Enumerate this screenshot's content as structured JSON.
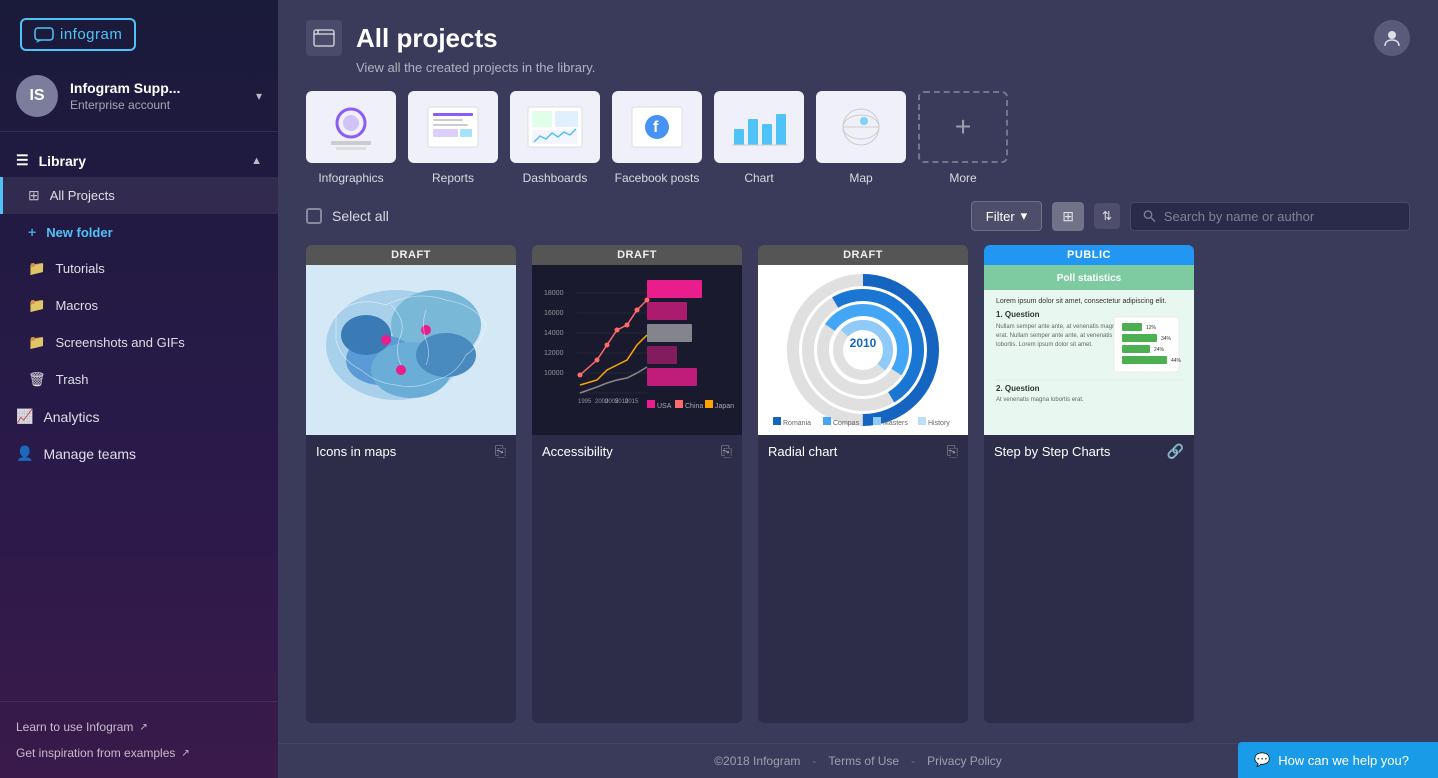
{
  "sidebar": {
    "logo": "infogram",
    "user": {
      "initials": "IS",
      "name": "Infogram Supp...",
      "role": "Enterprise account"
    },
    "library": {
      "label": "Library",
      "items": [
        {
          "id": "all-projects",
          "label": "All Projects",
          "active": true,
          "icon": "⊞"
        },
        {
          "id": "new-folder",
          "label": "New folder",
          "icon": "+"
        },
        {
          "id": "tutorials",
          "label": "Tutorials",
          "icon": "📁"
        },
        {
          "id": "macros",
          "label": "Macros",
          "icon": "📁"
        },
        {
          "id": "screenshots",
          "label": "Screenshots and GIFs",
          "icon": "📁"
        },
        {
          "id": "trash",
          "label": "Trash",
          "icon": "🗑"
        }
      ]
    },
    "analytics": {
      "label": "Analytics",
      "icon": "📈"
    },
    "manage_teams": {
      "label": "Manage teams",
      "icon": "👤"
    },
    "footer": {
      "learn": "Learn to use Infogram",
      "inspiration": "Get inspiration from examples"
    }
  },
  "header": {
    "page_icon": "📋",
    "title": "All projects",
    "subtitle": "View all the created projects in the library."
  },
  "template_types": [
    {
      "id": "infographics",
      "label": "Infographics",
      "selected": false
    },
    {
      "id": "reports",
      "label": "Reports",
      "selected": false
    },
    {
      "id": "dashboards",
      "label": "Dashboards",
      "selected": false
    },
    {
      "id": "facebook",
      "label": "Facebook posts",
      "selected": false
    },
    {
      "id": "chart",
      "label": "Chart",
      "selected": false
    },
    {
      "id": "map",
      "label": "Map",
      "selected": false
    },
    {
      "id": "more",
      "label": "More",
      "selected": false
    }
  ],
  "toolbar": {
    "select_all": "Select all",
    "filter": "Filter",
    "search_placeholder": "Search by name or author"
  },
  "projects": [
    {
      "id": "icons-maps",
      "status": "Draft",
      "status_type": "draft",
      "name": "Icons in maps",
      "type": "map",
      "has_copy": true,
      "has_share": false
    },
    {
      "id": "accessibility",
      "status": "Draft",
      "status_type": "draft",
      "name": "Accessibility",
      "type": "accessibility",
      "has_copy": true,
      "has_share": false
    },
    {
      "id": "radial-chart",
      "status": "Draft",
      "status_type": "draft",
      "name": "Radial chart",
      "type": "radial",
      "has_copy": true,
      "has_share": false
    },
    {
      "id": "step-by-step",
      "status": "Public",
      "status_type": "public",
      "name": "Step by Step Charts",
      "type": "step",
      "has_copy": false,
      "has_share": true
    }
  ],
  "footer": {
    "copyright": "©2018 Infogram",
    "terms": "Terms of Use",
    "privacy": "Privacy Policy"
  },
  "help_button": "How can we help you?"
}
